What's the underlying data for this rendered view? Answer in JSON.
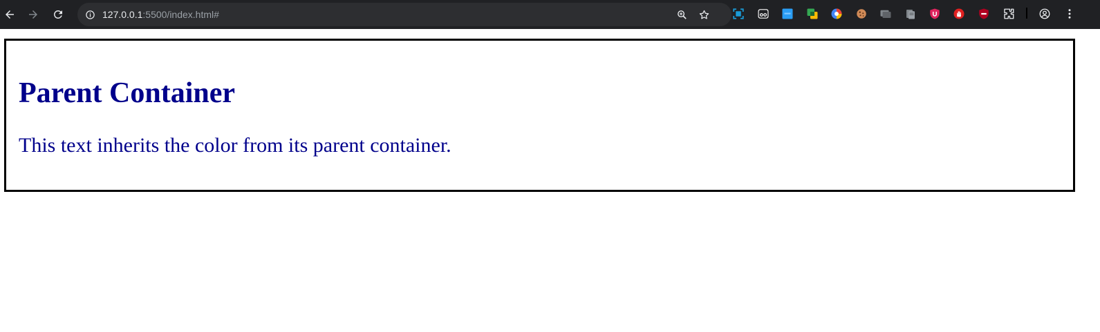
{
  "browser": {
    "url_host": "127.0.0.1",
    "url_path": ":5500/index.html#",
    "extensions": [
      {
        "name": "screenshot-extension-icon",
        "color": "#1a73e8"
      },
      {
        "name": "eyes-extension-icon",
        "color": "#ffffff"
      },
      {
        "name": "blue-square-extension-icon",
        "color": "#1a9bf0"
      },
      {
        "name": "yellow-green-extension-icon",
        "color": "#fbbc04"
      },
      {
        "name": "colorful-circle-extension-icon",
        "color": "#4285f4"
      },
      {
        "name": "cookie-extension-icon",
        "color": "#c77b4a"
      },
      {
        "name": "gray-cards-extension-icon",
        "color": "#9aa0a6"
      },
      {
        "name": "clipboard-extension-icon",
        "color": "#9aa0a6"
      },
      {
        "name": "pink-shield-extension-icon",
        "color": "#e0245e"
      },
      {
        "name": "red-hand-extension-icon",
        "color": "#e02020"
      },
      {
        "name": "red-block-extension-icon",
        "color": "#b00020"
      }
    ]
  },
  "content": {
    "heading": "Parent Container",
    "paragraph": "This text inherits the color from its parent container."
  },
  "colors": {
    "toolbar_bg": "#202124",
    "omnibox_bg": "#2d2e31",
    "text_color": "#00008b",
    "border_color": "#000000"
  }
}
